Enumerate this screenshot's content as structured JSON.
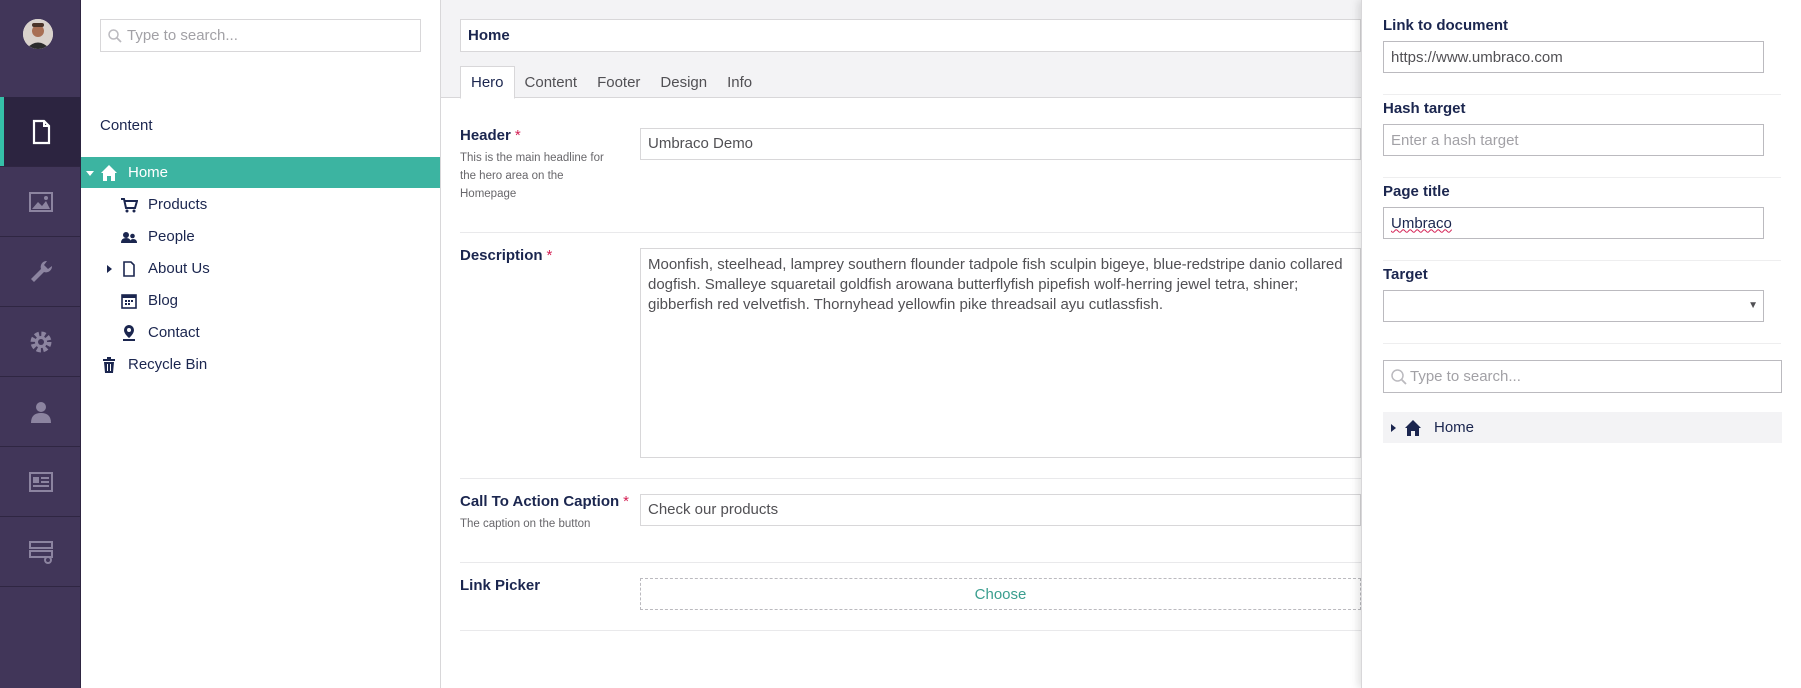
{
  "tree": {
    "search_placeholder": "Type to search...",
    "heading": "Content",
    "items": [
      {
        "label": "Home",
        "icon": "home-icon"
      },
      {
        "label": "Products",
        "icon": "cart-icon"
      },
      {
        "label": "People",
        "icon": "users-icon"
      },
      {
        "label": "About Us",
        "icon": "document-icon"
      },
      {
        "label": "Blog",
        "icon": "calendar-icon"
      },
      {
        "label": "Contact",
        "icon": "map-pin-icon"
      },
      {
        "label": "Recycle Bin",
        "icon": "trash-icon"
      }
    ]
  },
  "editor": {
    "name": "Home",
    "tabs": [
      "Hero",
      "Content",
      "Footer",
      "Design",
      "Info"
    ],
    "active_tab": "Hero",
    "properties": {
      "header": {
        "label": "Header",
        "required": "*",
        "description": "This is the main headline for the hero area on the Homepage",
        "value": "Umbraco Demo"
      },
      "description": {
        "label": "Description",
        "required": "*",
        "value": "Moonfish, steelhead, lamprey southern flounder tadpole fish sculpin bigeye, blue-redstripe danio collared dogfish. Smalleye squaretail goldfish arowana butterflyfish pipefish wolf-herring jewel tetra, shiner; gibberfish red velvetfish. Thornyhead yellowfin pike threadsail ayu cutlassfish."
      },
      "cta": {
        "label": "Call To Action Caption",
        "required": "*",
        "description": "The caption on the button",
        "value": "Check our products"
      },
      "link_picker": {
        "label": "Link Picker",
        "button": "Choose"
      }
    }
  },
  "overlay": {
    "link_to_document": {
      "label": "Link to document",
      "value": "https://www.umbraco.com"
    },
    "hash_target": {
      "label": "Hash target",
      "placeholder": "Enter a hash target"
    },
    "page_title": {
      "label": "Page title",
      "value": "Umbraco"
    },
    "target": {
      "label": "Target",
      "value": ""
    },
    "search_placeholder": "Type to search...",
    "tree_root": "Home"
  },
  "colors": {
    "sections_bg": "#413659",
    "accent": "#3cb4a1",
    "required": "#d42054"
  }
}
